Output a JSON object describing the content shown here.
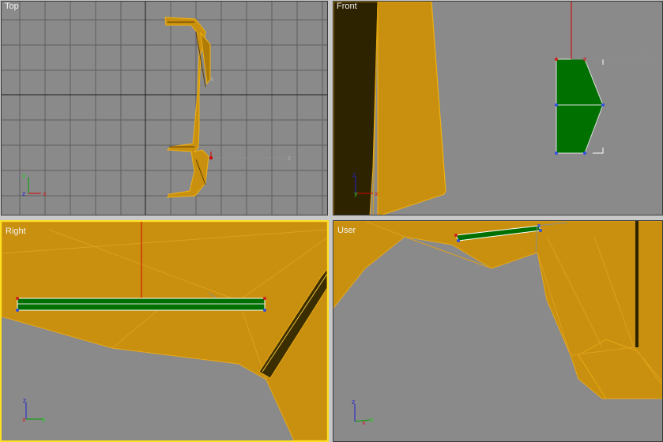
{
  "viewports": {
    "top": {
      "label": "Top",
      "active": false
    },
    "front": {
      "label": "Front",
      "active": false
    },
    "right": {
      "label": "Right",
      "active": true
    },
    "user": {
      "label": "User",
      "active": false
    }
  },
  "axes": {
    "x": "x",
    "y": "y",
    "z": "z"
  },
  "colors": {
    "viewport_bg": "#8a8a8a",
    "grid": "#5e5e5e",
    "grid_main": "#1c1c1c",
    "mesh_fill": "#c8900e",
    "mesh_edge": "#f0b010",
    "selection_fill": "#007000",
    "active_border": "#ffe020"
  }
}
